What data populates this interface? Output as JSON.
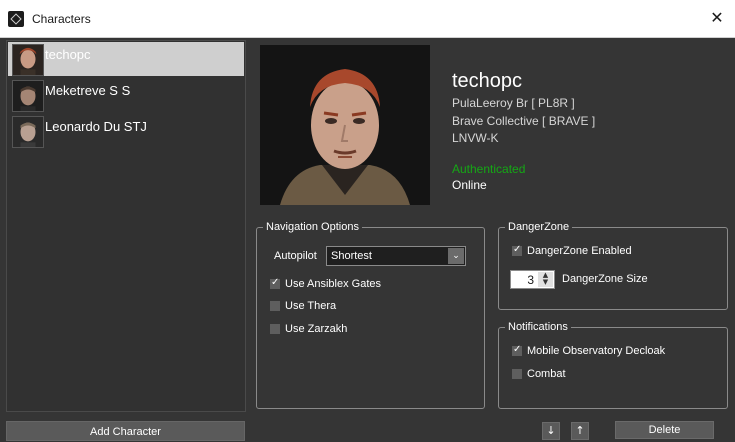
{
  "window": {
    "title": "Characters",
    "close_glyph": "✕"
  },
  "characters": [
    {
      "name": "techopc",
      "selected": true
    },
    {
      "name": "Meketreve S S",
      "selected": false
    },
    {
      "name": "Leonardo Du STJ",
      "selected": false
    }
  ],
  "add_character_label": "Add Character",
  "details": {
    "name": "techopc",
    "corporation": "PulaLeeroy Br  [ PL8R ]",
    "alliance": "Brave Collective  [ BRAVE ]",
    "location": "LNVW-K",
    "auth_status": "Authenticated",
    "online_status": "Online"
  },
  "navigation": {
    "legend": "Navigation Options",
    "autopilot_label": "Autopilot",
    "autopilot_value": "Shortest",
    "options": [
      {
        "label": "Use Ansiblex Gates",
        "checked": true
      },
      {
        "label": "Use Thera",
        "checked": false
      },
      {
        "label": "Use Zarzakh",
        "checked": false
      }
    ]
  },
  "dangerzone": {
    "legend": "DangerZone",
    "enabled_label": "DangerZone Enabled",
    "enabled": true,
    "size_value": "3",
    "size_label": "DangerZone Size"
  },
  "notifications": {
    "legend": "Notifications",
    "options": [
      {
        "label": "Mobile Observatory Decloak",
        "checked": true
      },
      {
        "label": "Combat",
        "checked": false
      }
    ]
  },
  "buttons": {
    "move_down": "↓",
    "move_up": "↑",
    "delete": "Delete"
  },
  "colors": {
    "background": "#353535",
    "authenticated": "#15a815",
    "selected_row": "#cfcfcf"
  }
}
